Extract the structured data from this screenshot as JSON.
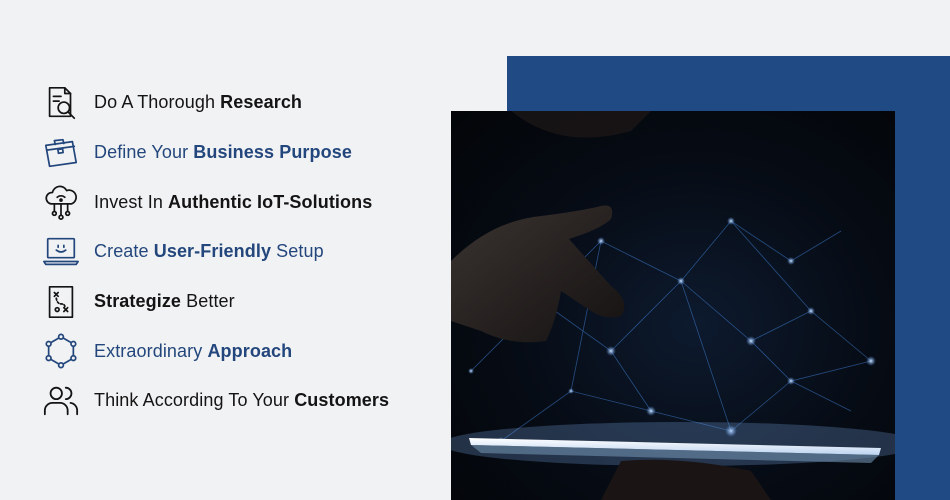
{
  "tips": [
    {
      "icon": "research-document-icon",
      "style": "dark",
      "before": "Do A Thorough ",
      "bold": "Research",
      "after": ""
    },
    {
      "icon": "briefcase-icon",
      "style": "blue",
      "before": "Define Your ",
      "bold": "Business Purpose",
      "after": ""
    },
    {
      "icon": "cloud-network-icon",
      "style": "dark",
      "before": "Invest In ",
      "bold": "Authentic IoT-Solutions",
      "after": ""
    },
    {
      "icon": "laptop-smile-icon",
      "style": "blue",
      "before": "Create ",
      "bold": "User-Friendly",
      "after": " Setup"
    },
    {
      "icon": "strategy-board-icon",
      "style": "dark",
      "before": "",
      "bold": "Strategize",
      "after": " Better"
    },
    {
      "icon": "hexagon-network-icon",
      "style": "blue",
      "before": "Extraordinary ",
      "bold": "Approach",
      "after": ""
    },
    {
      "icon": "users-icon",
      "style": "dark",
      "before": "Think According To Your ",
      "bold": "Customers",
      "after": ""
    }
  ],
  "colors": {
    "background": "#f1f2f4",
    "accent_blue": "#1f4a83",
    "text_blue": "#23477c",
    "text_dark": "#141414"
  }
}
